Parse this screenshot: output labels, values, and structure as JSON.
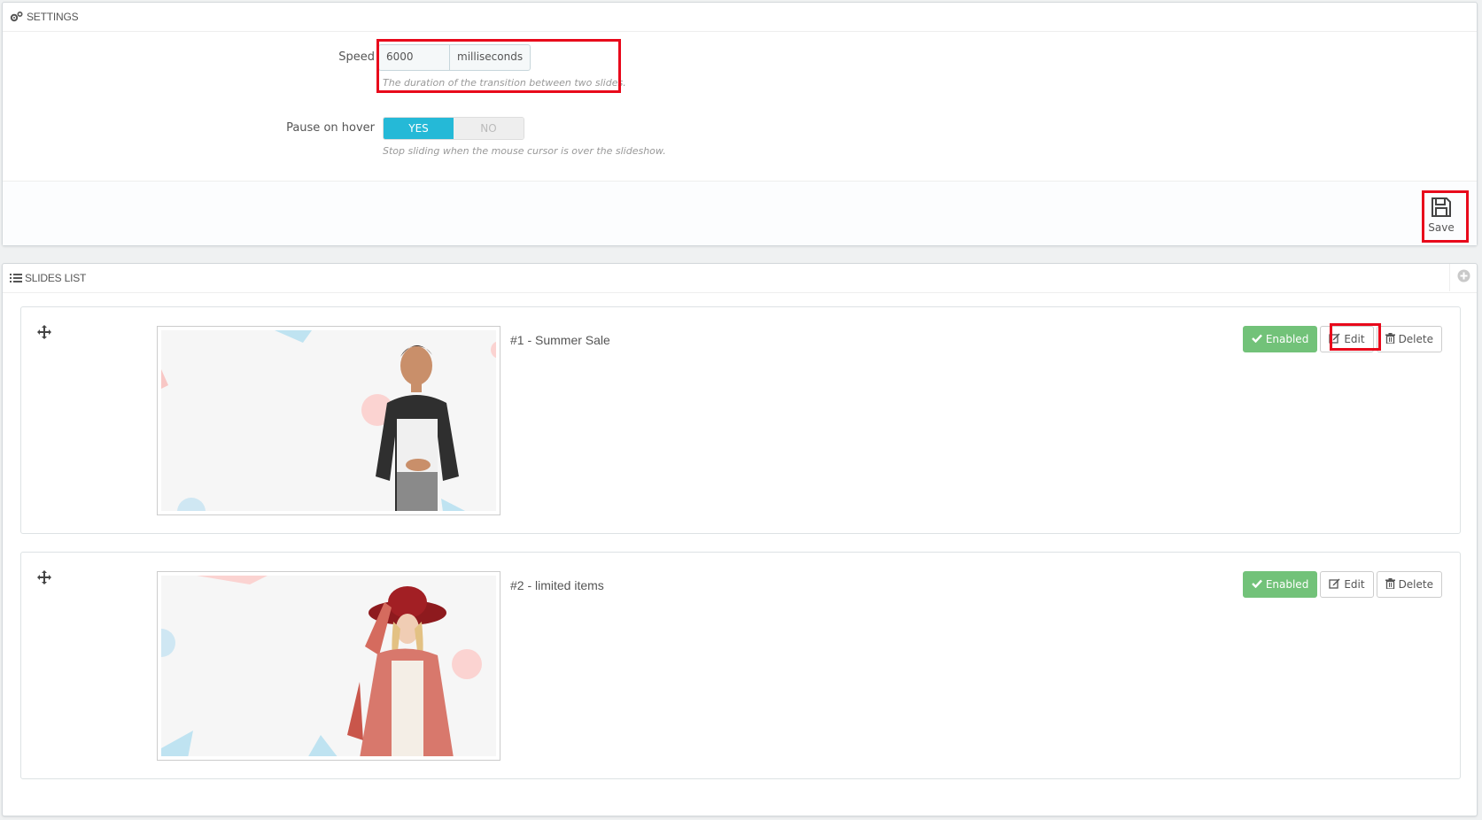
{
  "settings": {
    "heading": "SETTINGS",
    "speed_label": "Speed",
    "speed_value": "6000",
    "speed_unit": "milliseconds",
    "speed_help": "The duration of the transition between two slides.",
    "pause_label": "Pause on hover",
    "pause_yes": "YES",
    "pause_no": "NO",
    "pause_selected": "YES",
    "pause_help": "Stop sliding when the mouse cursor is over the slideshow.",
    "save_label": "Save"
  },
  "slides_list": {
    "heading": "SLIDES LIST",
    "slides": [
      {
        "title": "#1 - Summer Sale",
        "status": "Enabled",
        "edit": "Edit",
        "delete": "Delete"
      },
      {
        "title": "#2 - limited items",
        "status": "Enabled",
        "edit": "Edit",
        "delete": "Delete"
      }
    ]
  },
  "colors": {
    "accent": "#25b9d7",
    "enabled": "#72c279",
    "highlight": "#e8091b"
  },
  "icons": {
    "settings": "cogs-icon",
    "list": "list-icon",
    "save": "save-icon",
    "add": "plus-circle-icon",
    "move": "move-icon",
    "enabled": "check-icon",
    "edit": "edit-icon",
    "delete": "trash-icon"
  }
}
